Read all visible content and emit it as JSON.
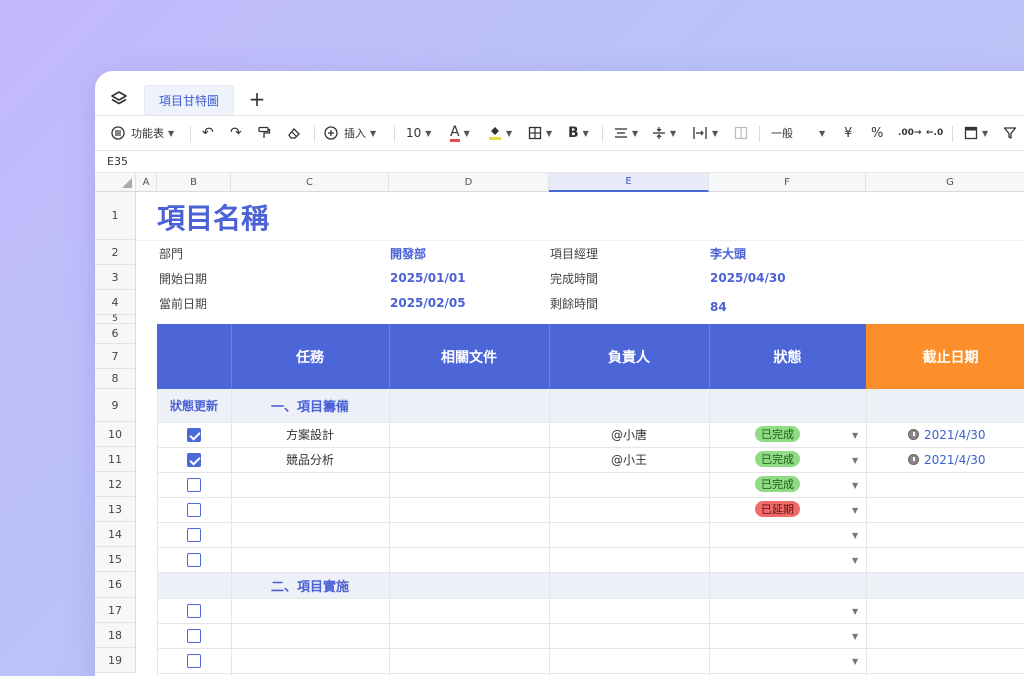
{
  "tabs": [
    {
      "label": "項目甘特圖",
      "active": true
    }
  ],
  "toolbar": {
    "menu_label": "功能表",
    "insert_label": "插入",
    "font_size": "10",
    "number_format": "一般",
    "currency_symbol": "¥",
    "percent_symbol": "%"
  },
  "name_box": "E35",
  "columns": [
    "A",
    "B",
    "C",
    "D",
    "E",
    "F",
    "G"
  ],
  "rows": [
    "1",
    "2",
    "3",
    "4",
    "5",
    "6",
    "7",
    "8",
    "9",
    "10",
    "11",
    "12",
    "13",
    "14",
    "15",
    "16",
    "17",
    "18",
    "19"
  ],
  "sheet": {
    "title": "項目名稱",
    "info": [
      {
        "label": "部門",
        "value": "開發部",
        "label2": "項目經理",
        "value2": "李大頭"
      },
      {
        "label": "開始日期",
        "value": "2025/01/01",
        "label2": "完成時間",
        "value2": "2025/04/30"
      },
      {
        "label": "當前日期",
        "value": "2025/02/05",
        "label2": "剩餘時間",
        "value2": "84"
      }
    ],
    "headers": {
      "task": "任務",
      "docs": "相關文件",
      "owner": "負責人",
      "status": "狀態",
      "deadline": "截止日期"
    },
    "status_update_label": "狀態更新",
    "section1": "一、項目籌備",
    "section2": "二、項目實施",
    "tasks": [
      {
        "checked": true,
        "name": "方案設計",
        "owner": "@小唐",
        "status": "已完成",
        "deadline": "2021/4/30"
      },
      {
        "checked": true,
        "name": "競品分析",
        "owner": "@小王",
        "status": "已完成",
        "deadline": "2021/4/30"
      },
      {
        "checked": false,
        "name": "",
        "owner": "",
        "status": "已完成",
        "deadline": ""
      },
      {
        "checked": false,
        "name": "",
        "owner": "",
        "status": "已延期",
        "deadline": ""
      },
      {
        "checked": false,
        "name": "",
        "owner": "",
        "status": "",
        "deadline": ""
      },
      {
        "checked": false,
        "name": "",
        "owner": "",
        "status": "",
        "deadline": ""
      }
    ],
    "tasks2": [
      {
        "checked": false
      },
      {
        "checked": false
      },
      {
        "checked": false
      }
    ]
  },
  "colors": {
    "accent": "#4c66d8",
    "orange": "#fc8f2b",
    "done": "#8fdc85",
    "late": "#f26a6a"
  }
}
